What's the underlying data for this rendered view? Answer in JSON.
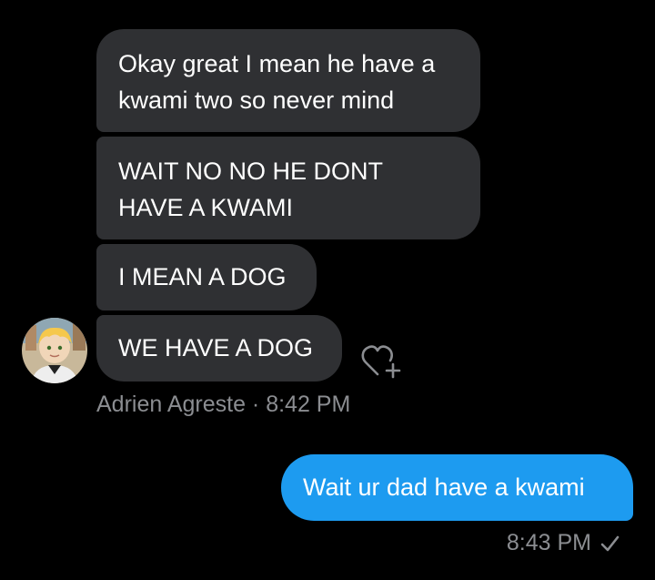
{
  "messages_received": [
    {
      "lines": [
        "Okay great I mean he have a",
        "kwami two so never mind"
      ]
    },
    {
      "lines": [
        "WAIT NO NO HE DONT",
        "HAVE A KWAMI"
      ]
    },
    {
      "lines": [
        "I MEAN A DOG"
      ]
    },
    {
      "lines": [
        "WE HAVE A DOG"
      ]
    }
  ],
  "received_meta": "Adrien Agreste · 8:42 PM",
  "sent_message": "Wait ur dad have a kwami",
  "sent_time": "8:43 PM",
  "icons": {
    "react": "heart-plus-icon",
    "status": "check-icon"
  },
  "colors": {
    "background": "#000000",
    "received_bubble": "#2f3033",
    "sent_bubble": "#1d9bf0",
    "meta_text": "#8b8d91"
  }
}
